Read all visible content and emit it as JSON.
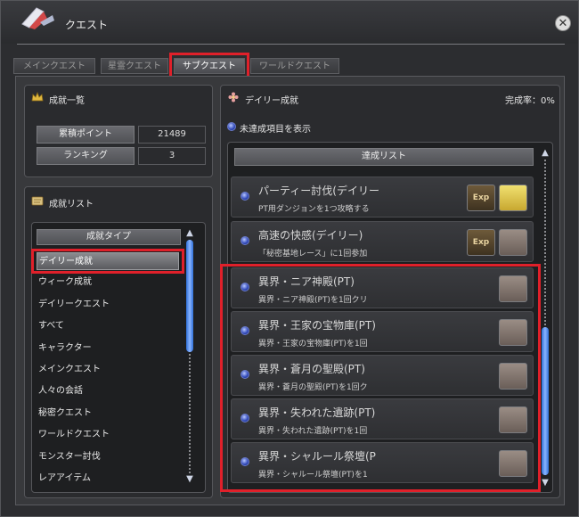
{
  "window": {
    "title": "クエスト"
  },
  "tabs": [
    {
      "label": "メインクエスト"
    },
    {
      "label": "星霊クエスト"
    },
    {
      "label": "サブクエスト"
    },
    {
      "label": "ワールドクエスト"
    }
  ],
  "achievements": {
    "title": "成就一覧",
    "stats": [
      {
        "label": "累積ポイント",
        "value": "21489"
      },
      {
        "label": "ランキング",
        "value": "3"
      }
    ]
  },
  "achievement_list": {
    "title": "成就リスト",
    "header": "成就タイプ",
    "categories": [
      "デイリー成就",
      "ウィーク成就",
      "デイリークエスト",
      "すべて",
      "キャラクター",
      "メインクエスト",
      "人々の会話",
      "秘密クエスト",
      "ワールドクエスト",
      "モンスター討伐",
      "レアアイテム"
    ]
  },
  "daily": {
    "title": "デイリー成就",
    "completion": "完成率：0%",
    "show_incomplete": "未達成項目を表示",
    "list_header": "達成リスト",
    "items": [
      {
        "name": "パーティー討伐(デイリー",
        "desc": "PT用ダンジョンを1つ攻略する",
        "reward_label": "Exp"
      },
      {
        "name": "高速の快感(デイリー)",
        "desc": "「秘密基地レース」に1回参加",
        "reward_label": "Exp"
      },
      {
        "name": "異界・ニア神殿(PT)",
        "desc": "異界・ニア神殿(PT)を1回クリ"
      },
      {
        "name": "異界・王家の宝物庫(PT)",
        "desc": "異界・王家の宝物庫(PT)を1回"
      },
      {
        "name": "異界・蒼月の聖殿(PT)",
        "desc": "異界・蒼月の聖殿(PT)を1回ク"
      },
      {
        "name": "異界・失われた遺跡(PT)",
        "desc": "異界・失われた遺跡(PT)を1回"
      },
      {
        "name": "異界・シャルール祭壇(P",
        "desc": "異界・シャルール祭壇(PT)を1"
      }
    ]
  },
  "colors": {
    "highlight": "#e0202a",
    "scroll": "#2f6fd8"
  }
}
